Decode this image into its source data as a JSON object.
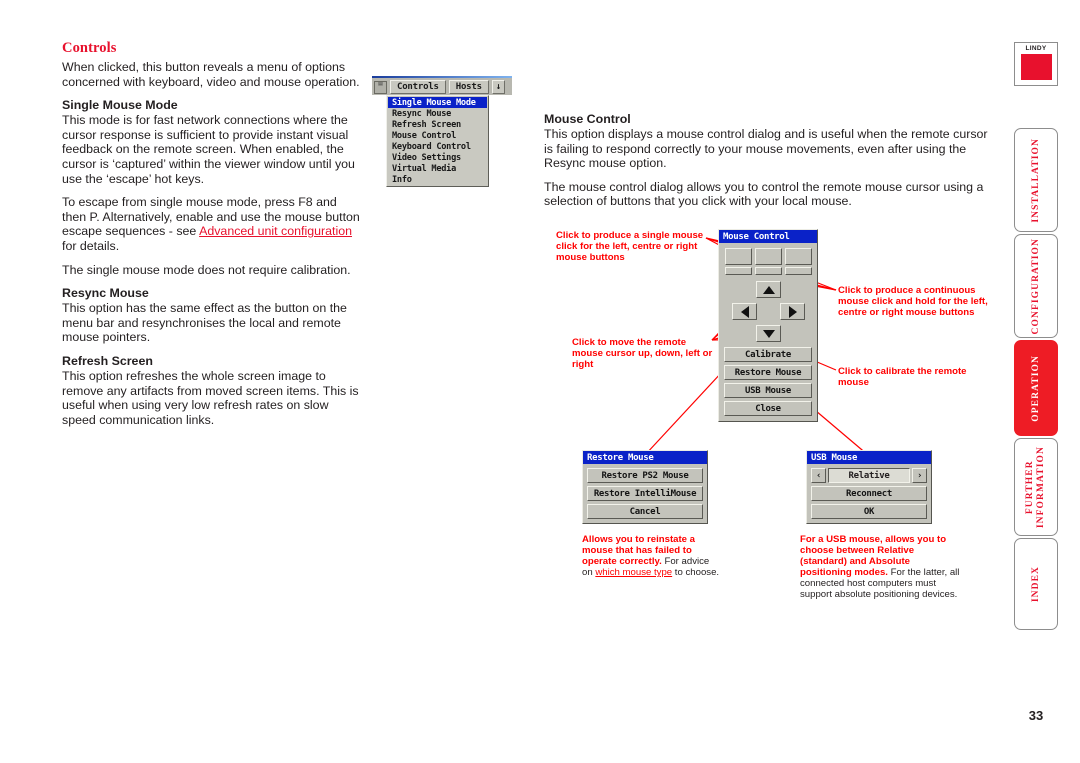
{
  "page_number": "33",
  "brand": {
    "name": "LINDY",
    "accent": "#e8112d"
  },
  "sidebar": {
    "tabs": [
      {
        "label": "INSTALLATION",
        "active": false
      },
      {
        "label": "CONFIGURATION",
        "active": false
      },
      {
        "label": "OPERATION",
        "active": true
      },
      {
        "label": "FURTHER\nINFORMATION",
        "active": false
      },
      {
        "label": "INDEX",
        "active": false
      }
    ]
  },
  "left_column": {
    "title": "Controls",
    "intro": "When clicked, this button reveals a menu of options concerned with keyboard, video and mouse operation.",
    "sections": [
      {
        "heading": "Single Mouse Mode",
        "paragraphs": [
          "This mode is for fast network connections where the cursor response is sufficient to provide instant visual feedback on the remote screen. When enabled, the cursor is ‘captured’ within the viewer window until you use the ‘escape’ hot keys."
        ]
      }
    ],
    "escape_para_pre": "To escape from single mouse mode, press F8 and then P. Alternatively, enable and use the mouse button escape sequences - see ",
    "escape_link": "Advanced unit configuration",
    "escape_para_post": " for details.",
    "calibration_note": "The single mouse mode does not require calibration.",
    "resync": {
      "heading": "Resync Mouse",
      "text": "This option has the same effect as the button on the menu bar and resynchronises the local and remote mouse pointers."
    },
    "refresh": {
      "heading": "Refresh Screen",
      "text": "This option refreshes the whole screen image to remove any artifacts from moved screen items. This is useful when using very low refresh rates on slow speed communication links."
    }
  },
  "menu_screenshot": {
    "icon_label": "settings-icon",
    "bar_buttons": [
      "Controls",
      "Hosts"
    ],
    "bar_button_extra": "↓",
    "items": [
      {
        "label": "Single Mouse Mode",
        "selected": true
      },
      {
        "label": "Resync Mouse",
        "selected": false
      },
      {
        "label": "Refresh Screen",
        "selected": false
      },
      {
        "label": "Mouse Control",
        "selected": false
      },
      {
        "label": "Keyboard Control",
        "selected": false
      },
      {
        "label": "Video Settings",
        "selected": false
      },
      {
        "label": "Virtual Media",
        "selected": false
      },
      {
        "label": "Info",
        "selected": false
      }
    ]
  },
  "right_column": {
    "heading": "Mouse Control",
    "paragraph1": "This option displays a mouse control dialog and is useful when the remote cursor is failing to respond correctly to your mouse movements, even after using the Resync mouse option.",
    "paragraph2": "The mouse control dialog allows you to control the remote mouse cursor using a selection of buttons that you click with your local mouse."
  },
  "mouse_control_dialog": {
    "title": "Mouse Control",
    "buttons": [
      "Calibrate",
      "Restore Mouse",
      "USB Mouse",
      "Close"
    ],
    "dpad": [
      "up-arrow",
      "left-arrow",
      "right-arrow",
      "down-arrow"
    ],
    "click_buttons_count": 3,
    "hold_buttons_count": 3
  },
  "restore_mouse_dialog": {
    "title": "Restore Mouse",
    "buttons": [
      "Restore PS2 Mouse",
      "Restore IntelliMouse",
      "Cancel"
    ]
  },
  "usb_mouse_dialog": {
    "title": "USB Mouse",
    "value": "Relative",
    "prev_arrow": "‹",
    "next_arrow": "›",
    "buttons": [
      "Reconnect",
      "OK"
    ]
  },
  "callouts": {
    "single_click": "Click to produce a single mouse click for the left, centre or right mouse buttons",
    "continuous_click": "Click to produce a continuous mouse click and hold for the left, centre or right mouse buttons",
    "move_cursor": "Click to move the remote mouse cursor up, down, left or right",
    "calibrate": "Click to calibrate the remote mouse"
  },
  "captions": {
    "restore_bold": "Allows you to reinstate a mouse that has failed to operate correctly.",
    "restore_plain_pre": "For advice on ",
    "restore_link": "which mouse type",
    "restore_plain_post": " to choose.",
    "usb_bold": "For a USB mouse, allows you to choose between Relative (standard) and Absolute positioning modes.",
    "usb_plain": "For the latter, all connected host computers must support absolute positioning devices."
  }
}
